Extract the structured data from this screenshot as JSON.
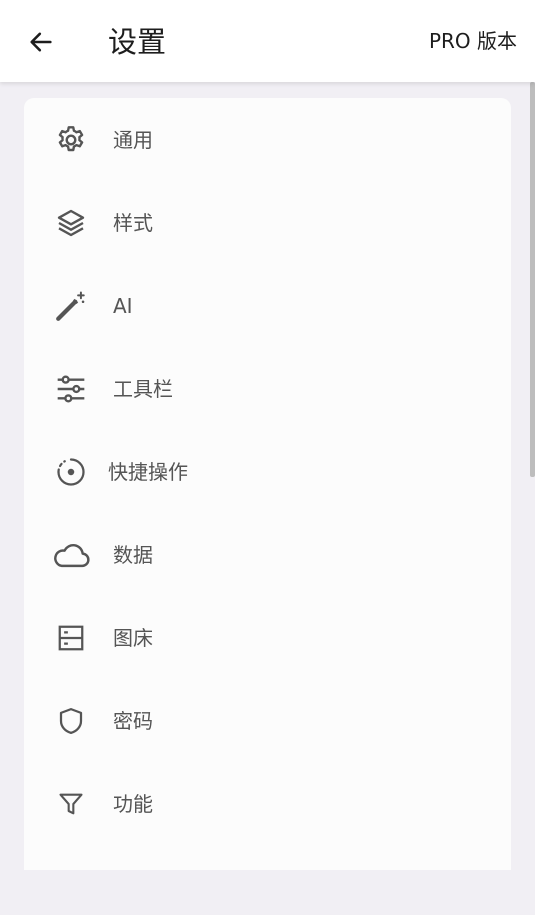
{
  "appbar": {
    "title": "设置",
    "pro_label": "PRO 版本",
    "back_icon": "arrow-left-icon"
  },
  "settings": {
    "items": [
      {
        "label": "通用",
        "icon": "gear-icon"
      },
      {
        "label": "样式",
        "icon": "layers-icon"
      },
      {
        "label": "AI",
        "icon": "magic-wand-icon"
      },
      {
        "label": "工具栏",
        "icon": "sliders-icon"
      },
      {
        "label": "快捷操作",
        "icon": "target-icon"
      },
      {
        "label": "数据",
        "icon": "cloud-icon"
      },
      {
        "label": "图床",
        "icon": "server-icon"
      },
      {
        "label": "密码",
        "icon": "shield-icon"
      },
      {
        "label": "功能",
        "icon": "filter-icon"
      }
    ]
  },
  "colors": {
    "background": "#f1eff4",
    "card": "#fcfcfc",
    "icon": "#555555",
    "text": "#1d1d1d"
  }
}
